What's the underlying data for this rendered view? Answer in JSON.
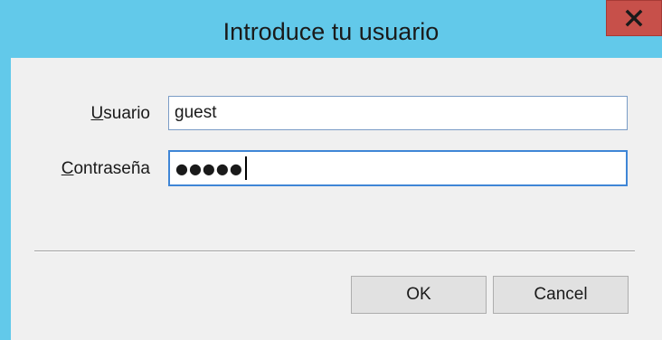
{
  "window": {
    "title": "Introduce tu usuario",
    "close_icon": "close-icon"
  },
  "form": {
    "username_label_mnemonic": "U",
    "username_label_rest": "suario",
    "username_value": "guest",
    "password_label_mnemonic": "C",
    "password_label_rest": "ontraseña",
    "password_masked": "●●●●●"
  },
  "buttons": {
    "ok_label": "OK",
    "cancel_label": "Cancel"
  },
  "colors": {
    "titlebar": "#62c9ea",
    "close_button": "#c7504a",
    "input_border": "#7a9cc6"
  }
}
